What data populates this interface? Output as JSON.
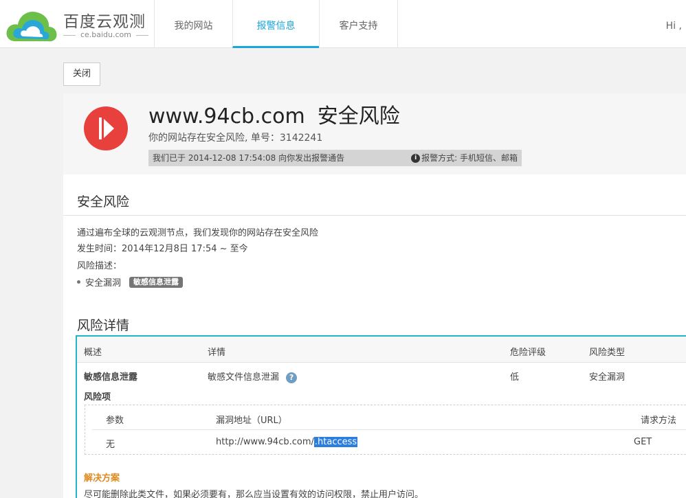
{
  "brand": {
    "title": "百度云观测",
    "subtitle": "ce.baidu.com",
    "colors": {
      "accent": "#1aa6d8",
      "cloud_green": "#6cc04a",
      "cloud_blue": "#2aa7d9"
    }
  },
  "nav": {
    "items": [
      {
        "label": "我的网站",
        "active": false
      },
      {
        "label": "报警信息",
        "active": true
      },
      {
        "label": "客户支持",
        "active": false
      }
    ],
    "user_greeting": "Hi ,"
  },
  "actions": {
    "close_label": "关闭"
  },
  "alert": {
    "site": "www.94cb.com",
    "type": "安全风险",
    "subtitle": "你的网站存在安全风险, 单号：3142241",
    "notice": "我们已于 2014-12-08 17:54:08 向你发出报警通告",
    "method": "报警方式: 手机短信、邮箱",
    "icon": "alert-flag-icon",
    "color": "#e8403d"
  },
  "risk": {
    "section_title": "安全风险",
    "line1": "通过遍布全球的云观测节点，我们发现你的网站存在安全风险",
    "time": "发生时间：2014年12月8日 17:54 ~ 至今",
    "desc_label": "风险描述：",
    "item": "安全漏洞",
    "tag": "敏感信息泄露"
  },
  "details": {
    "section_title": "风险详情",
    "headers": {
      "overview": "概述",
      "detail": "详情",
      "level": "危险评级",
      "type": "风险类型"
    },
    "row": {
      "overview": "敏感信息泄露",
      "detail": "敏感文件信息泄漏",
      "level": "低",
      "type": "安全漏洞"
    },
    "risk_items_label": "风险项",
    "inner_headers": {
      "param": "参数",
      "url": "漏洞地址（URL）",
      "method": "请求方法"
    },
    "inner_row": {
      "param": "无",
      "url_prefix": "http://www.94cb.com/",
      "url_highlight": ".htaccess",
      "method": "GET"
    },
    "solution_title": "解决方案",
    "solution_text": "尽可能删除此类文件，如果必须要有，那么应当设置有效的访问权限，禁止用户访问。",
    "border_color": "#23b4c5",
    "solution_color": "#e08a1e"
  }
}
